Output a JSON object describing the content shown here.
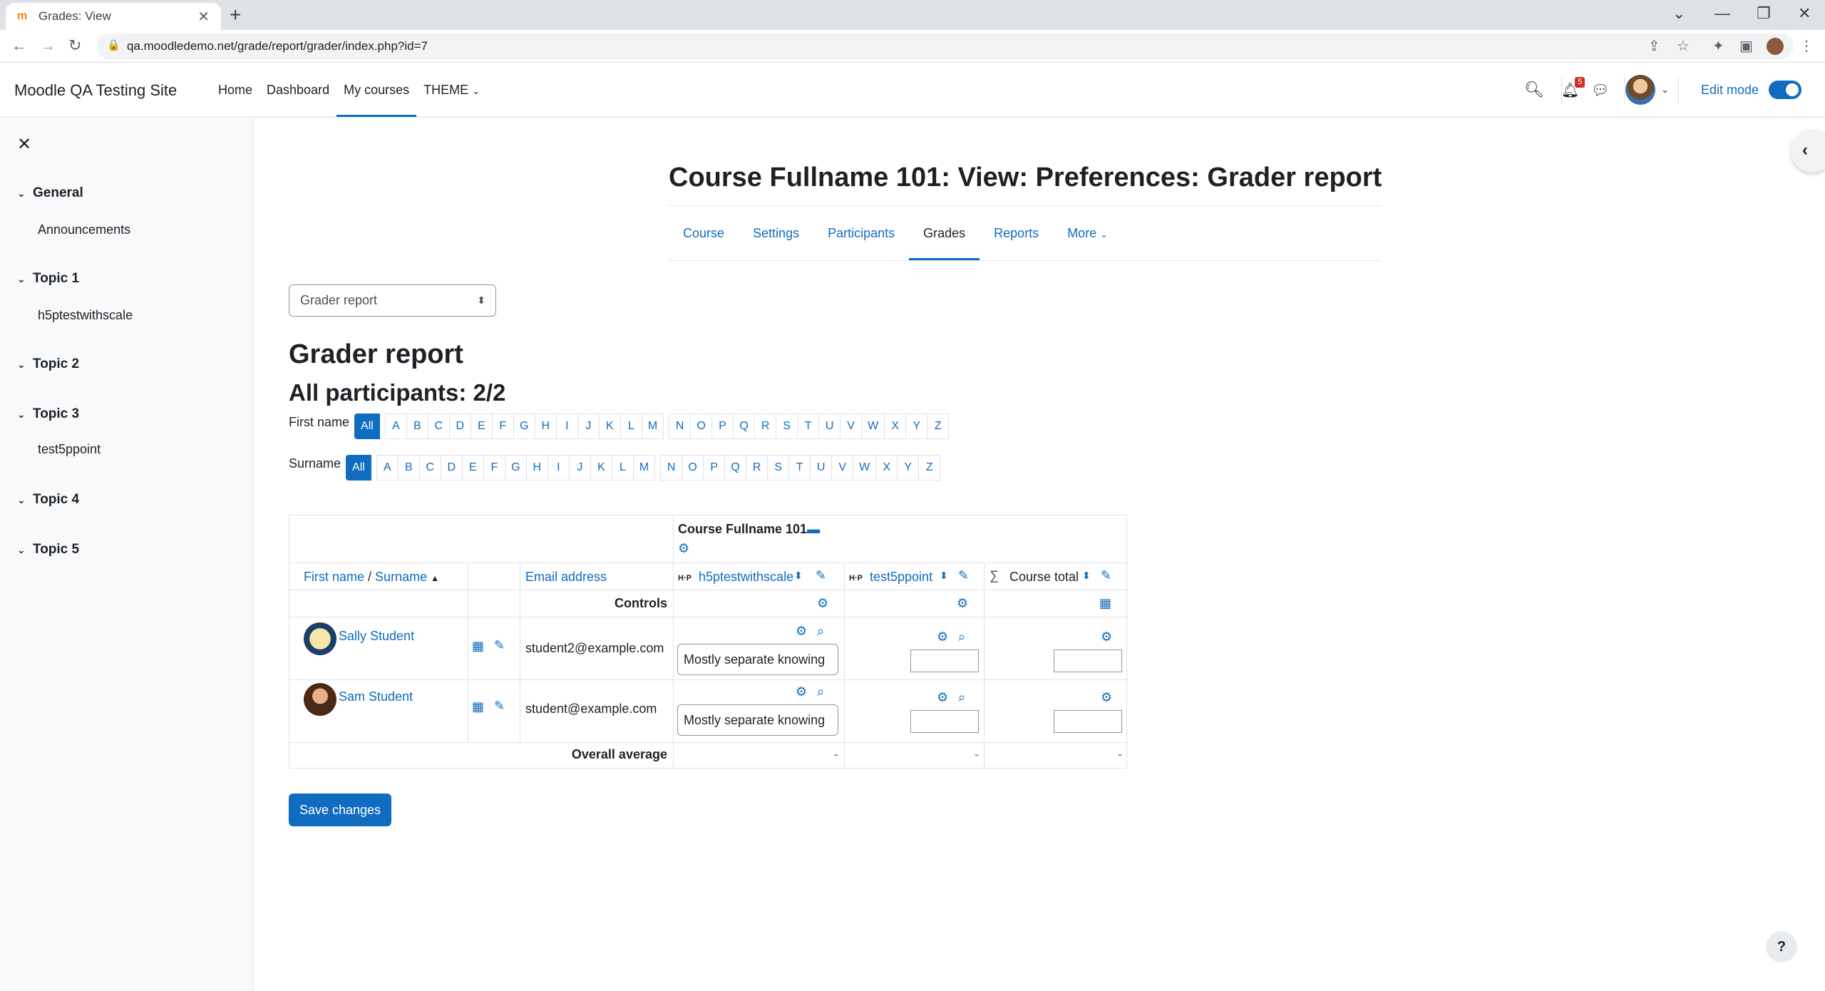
{
  "browser": {
    "tab_title": "Grades: View",
    "url": "qa.moodledemo.net/grade/report/grader/index.php?id=7"
  },
  "site": {
    "name": "Moodle QA Testing Site",
    "nav": [
      "Home",
      "Dashboard",
      "My courses",
      "THEME"
    ],
    "notifications_count": "5",
    "edit_mode_label": "Edit mode"
  },
  "drawer": {
    "sections": [
      {
        "title": "General",
        "items": [
          "Announcements"
        ]
      },
      {
        "title": "Topic 1",
        "items": [
          "h5ptestwithscale"
        ]
      },
      {
        "title": "Topic 2",
        "items": []
      },
      {
        "title": "Topic 3",
        "items": [
          "test5ppoint"
        ]
      },
      {
        "title": "Topic 4",
        "items": []
      },
      {
        "title": "Topic 5",
        "items": []
      }
    ]
  },
  "page": {
    "heading": "Course Fullname 101: View: Preferences: Grader report",
    "secnav": [
      "Course",
      "Settings",
      "Participants",
      "Grades",
      "Reports",
      "More"
    ],
    "report_selector": "Grader report",
    "title": "Grader report",
    "participants": "All participants: 2/2"
  },
  "initials": {
    "firstname_label": "First name",
    "surname_label": "Surname",
    "all": "All",
    "letters": [
      "A",
      "B",
      "C",
      "D",
      "E",
      "F",
      "G",
      "H",
      "I",
      "J",
      "K",
      "L",
      "M",
      "N",
      "O",
      "P",
      "Q",
      "R",
      "S",
      "T",
      "U",
      "V",
      "W",
      "X",
      "Y",
      "Z"
    ]
  },
  "grader": {
    "category": "Course Fullname 101",
    "col_firstname": "First name",
    "col_sep": " / ",
    "col_surname": "Surname",
    "col_email": "Email address",
    "items": [
      "h5ptestwithscale",
      "test5ppoint",
      "Course total"
    ],
    "controls_label": "Controls",
    "students": [
      {
        "name": "Sally Student",
        "email": "student2@example.com",
        "scale": "Mostly separate knowing"
      },
      {
        "name": "Sam Student",
        "email": "student@example.com",
        "scale": "Mostly separate knowing"
      }
    ],
    "overall_label": "Overall average",
    "overall": [
      "-",
      "-",
      "-"
    ]
  },
  "save_label": "Save changes",
  "help_label": "?"
}
